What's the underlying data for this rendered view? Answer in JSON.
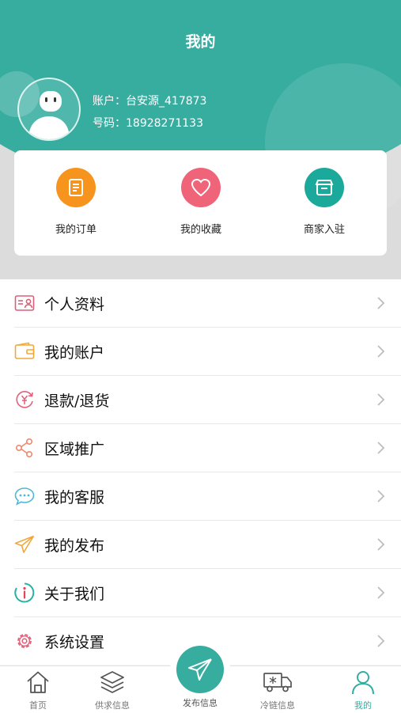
{
  "header": {
    "title": "我的"
  },
  "user": {
    "account": "账户：台安源_417873",
    "phone": "号码：18928271133"
  },
  "quick_actions": [
    {
      "label": "我的订单",
      "icon": "order-list-icon",
      "color": "#f7941d"
    },
    {
      "label": "我的收藏",
      "icon": "heart-icon",
      "color": "#f0647a"
    },
    {
      "label": "商家入驻",
      "icon": "store-icon",
      "color": "#1ba99b"
    }
  ],
  "menu": [
    {
      "label": "个人资料",
      "icon": "profile-card-icon"
    },
    {
      "label": "我的账户",
      "icon": "wallet-icon"
    },
    {
      "label": "退款/退货",
      "icon": "refund-icon"
    },
    {
      "label": "区域推广",
      "icon": "share-icon"
    },
    {
      "label": "我的客服",
      "icon": "chat-icon"
    },
    {
      "label": "我的发布",
      "icon": "paper-plane-icon"
    },
    {
      "label": "关于我们",
      "icon": "info-icon"
    },
    {
      "label": "系统设置",
      "icon": "gear-icon"
    }
  ],
  "tabs": [
    {
      "label": "首页",
      "icon": "home-icon"
    },
    {
      "label": "供求信息",
      "icon": "layers-icon"
    },
    {
      "label": "发布信息",
      "icon": "paper-plane-icon"
    },
    {
      "label": "冷链信息",
      "icon": "truck-icon"
    },
    {
      "label": "我的",
      "icon": "user-icon",
      "active": true
    }
  ],
  "colors": {
    "brand": "#37ada0",
    "background": "#f2f2f2"
  }
}
